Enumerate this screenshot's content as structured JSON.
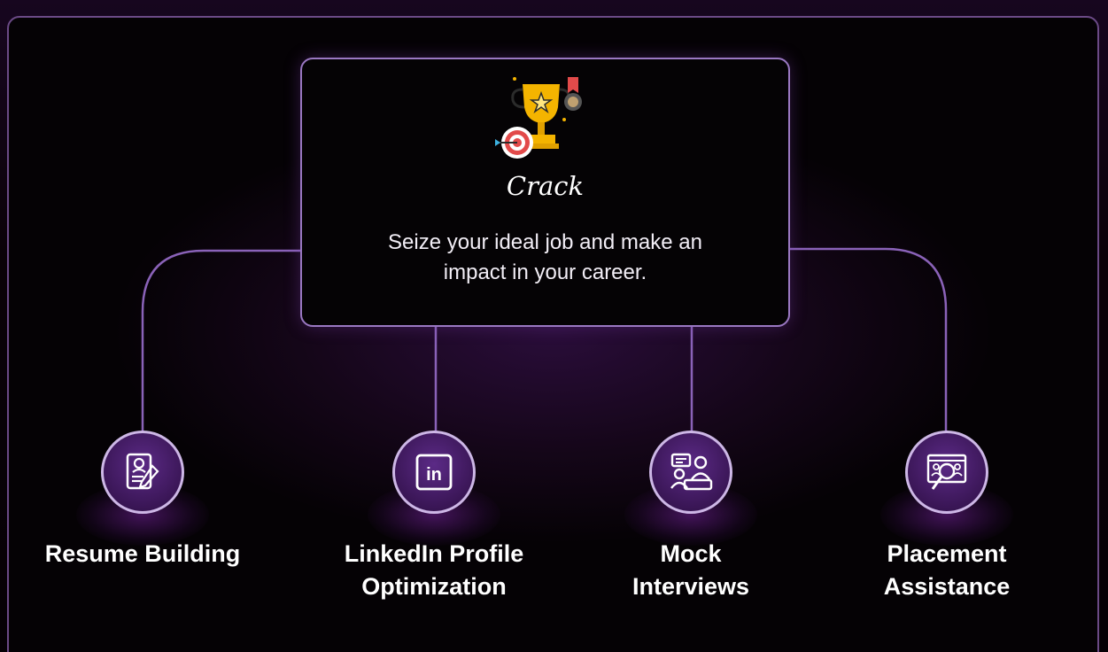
{
  "center": {
    "title": "Crack",
    "description": "Seize your ideal job and make an impact in your career.",
    "icon": "trophy-target-medal-icon"
  },
  "nodes": [
    {
      "label": "Resume Building",
      "icon": "resume-edit-icon"
    },
    {
      "label": "LinkedIn Profile\nOptimization",
      "icon": "linkedin-icon"
    },
    {
      "label": "Mock\nInterviews",
      "icon": "interview-chat-icon"
    },
    {
      "label": "Placement\nAssistance",
      "icon": "job-search-icon"
    }
  ],
  "colors": {
    "background": "#060106",
    "panel_border": "#6b4a86",
    "connector": "#8a62b8",
    "node_fill": "#3a1656",
    "node_border": "#cdb7e6",
    "text": "#ffffff"
  }
}
